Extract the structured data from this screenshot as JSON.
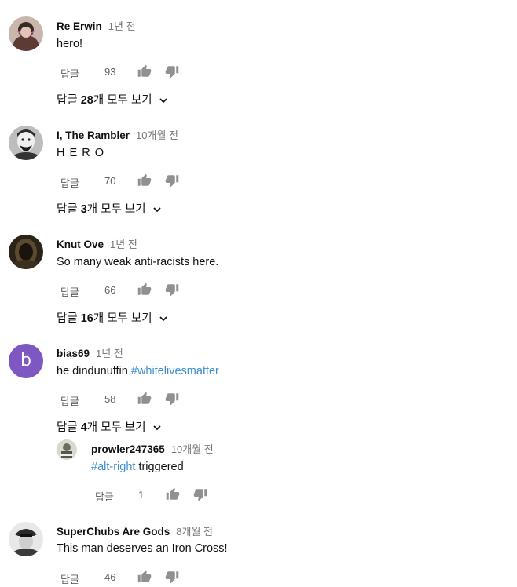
{
  "labels": {
    "reply": "답글",
    "view_prefix": "답글 ",
    "view_suffix": "개 모두 보기"
  },
  "colors": {
    "hashtag": "#3e8ed0",
    "muted": "#606060",
    "letter_avatar_bg": "#7e57c2"
  },
  "comments": [
    {
      "author": "Re Erwin",
      "time": "1년 전",
      "text": "hero!",
      "likes": "93",
      "reply_count": "28"
    },
    {
      "author": "I, The Rambler",
      "time": "10개월 전",
      "text": "H E R O",
      "likes": "70",
      "reply_count": "3"
    },
    {
      "author": "Knut Ove",
      "time": "1년 전",
      "text": "So many weak anti-racists here.",
      "likes": "66",
      "reply_count": "16"
    },
    {
      "author": "bias69",
      "avatar_letter": "b",
      "time": "1년 전",
      "text": "he dindunuffin ",
      "hashtag": "#whitelivesmatter",
      "likes": "58",
      "reply_count": "4"
    },
    {
      "author": "SuperChubs Are Gods",
      "time": "8개월 전",
      "text": "This man deserves an Iron Cross!",
      "likes": "46"
    }
  ],
  "reply": {
    "author": "prowler247365",
    "time": "10개월 전",
    "hashtag": "#alt-right",
    "text": " triggered",
    "likes": "1"
  }
}
